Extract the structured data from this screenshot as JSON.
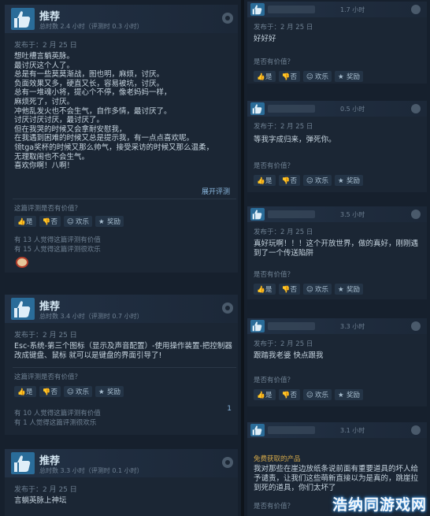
{
  "left_reviews": [
    {
      "title": "推荐",
      "hours": "总时数 2.4 小时（评测时 0.3 小时）",
      "posted": "发布于：2 月 25 日",
      "body": "想吐槽言躺英脉。\n最讨厌这个人了。\n总是有一些莫莫渐战，图也明，麻烦，讨厌。\n负面效果又多，硬直又长，容易被坑，讨厌。\n总有一堆魂小将，提心个不停，像老妈妈一样，\n麻烦死了，讨厌。\n冲他乱发火也不会生气，自作多情，最讨厌了。\n讨厌讨厌讨厌，最讨厌了。\n但在我哭的时候又会拿耐安慰我，\n在我遇到困难的时候又总是提示我，有一点点喜欢呢。\n领tga奖杯的时候又那么帅气，接受采访的时候又那么温柔，\n无理取闹也不会生气。\n喜欢你啊！八啊！",
      "expand": "展开评测",
      "helpful_q": "这篇评测是否有价值？",
      "votes": [
        "是",
        "否",
        "欢乐",
        "奖励"
      ],
      "stat1": "有 13 人觉得这篇评测有价值",
      "stat2": "有 15 人觉得这篇评测很欢乐"
    },
    {
      "title": "推荐",
      "hours": "总时数 3.4 小时（评测时 0.7 小时）",
      "posted": "发布于：2 月 25 日",
      "body": "Esc-系统-第三个图标（显示及声音配置）-使用操作装置-把控制器\n改成键盘、鼠标 就可以是键盘的界面引导了!",
      "helpful_q": "这篇评测是否有价值？",
      "votes": [
        "是",
        "否",
        "欢乐",
        "奖励"
      ],
      "stat1": "有 10 人觉得这篇评测有价值",
      "stat2": "有 1 人觉得这篇评测很欢乐",
      "comments": "1"
    },
    {
      "title": "推荐",
      "hours": "总时数 3.3 小时（评测时 0.1 小时）",
      "posted": "发布于：2 月 25 日",
      "body": "言躺英脉上神坛"
    }
  ],
  "right_reviews": [
    {
      "hours": "1.7 小时",
      "posted": "发布于：2 月 25 日",
      "body": "好好好",
      "helpful_q": "是否有价值？",
      "votes": [
        "是",
        "否",
        "欢乐",
        "奖励"
      ]
    },
    {
      "hours": "0.5 小时",
      "posted": "发布于：2 月 25 日",
      "body": "等我字成归来，弹死你。",
      "helpful_q": "是否有价值？",
      "votes": [
        "是",
        "否",
        "欢乐",
        "奖励"
      ]
    },
    {
      "hours": "3.5 小时",
      "posted": "发布于：2 月 25 日",
      "body": "真好玩啊！！！这个开放世界，做的真好，刚刚遇\n到了一个传送陷阱",
      "helpful_q": "是否有价值？",
      "votes": [
        "是",
        "否",
        "欢乐",
        "奖励"
      ]
    },
    {
      "hours": "3.3 小时",
      "posted": "发布于：2 月 25 日",
      "body": "跟踏我老婆 快点跟我",
      "helpful_q": "是否有价值？",
      "votes": [
        "是",
        "否",
        "欢乐",
        "奖励"
      ]
    },
    {
      "hours": "3.1 小时",
      "free": "免费获取的产品",
      "body": "我对那些在崖边放纸条说前面有重要道具的坏人给\n予谴责，让我们这些萌新直接以为是真的，跳崖拉\n到死的道具，你们太坏了",
      "helpful_q": "是否有价值？"
    }
  ],
  "watermark": "浩纳同游戏网",
  "colors": {
    "accent": "#2a6c99",
    "link": "#8bb9e0",
    "free": "#d3a84a"
  }
}
